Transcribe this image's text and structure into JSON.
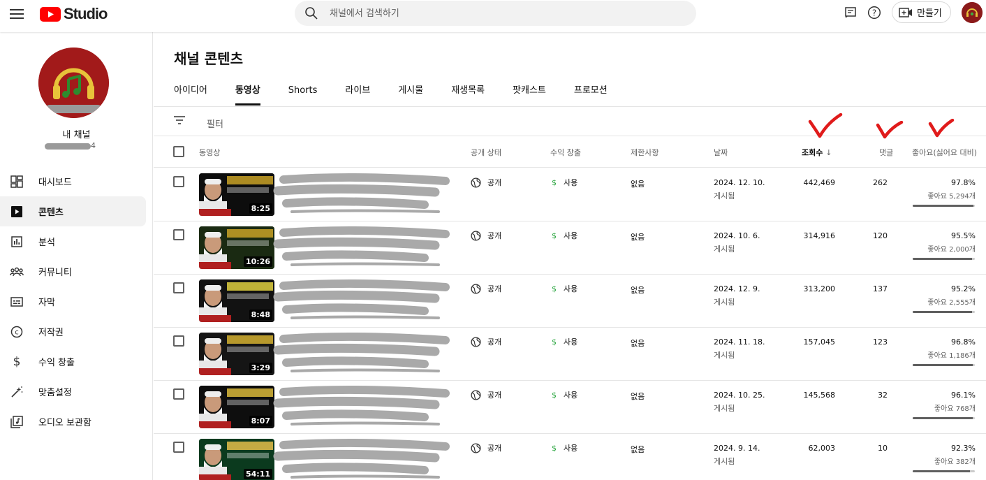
{
  "header": {
    "logo_text": "Studio",
    "search_placeholder": "채널에서 검색하기",
    "create_label": "만들기"
  },
  "sidebar": {
    "channel_label": "내 채널",
    "channel_sub_suffix": "4",
    "items": [
      {
        "label": "대시보드",
        "icon": "dashboard-icon",
        "active": false
      },
      {
        "label": "콘텐츠",
        "icon": "content-icon",
        "active": true
      },
      {
        "label": "분석",
        "icon": "analytics-icon",
        "active": false
      },
      {
        "label": "커뮤니티",
        "icon": "community-icon",
        "active": false
      },
      {
        "label": "자막",
        "icon": "subtitles-icon",
        "active": false
      },
      {
        "label": "저작권",
        "icon": "copyright-icon",
        "active": false
      },
      {
        "label": "수익 창출",
        "icon": "monetization-icon",
        "active": false
      },
      {
        "label": "맞춤설정",
        "icon": "customization-icon",
        "active": false
      },
      {
        "label": "오디오 보관함",
        "icon": "audio-library-icon",
        "active": false
      }
    ]
  },
  "main": {
    "title": "채널 콘텐츠",
    "tabs": [
      "아이디어",
      "동영상",
      "Shorts",
      "라이브",
      "게시물",
      "재생목록",
      "팟캐스트",
      "프로모션"
    ],
    "active_tab": 1,
    "filter_label": "필터",
    "columns": {
      "video": "동영상",
      "visibility": "공개 상태",
      "monetization": "수익 창출",
      "restrictions": "제한사항",
      "date": "날짜",
      "views": "조회수",
      "comments": "댓글",
      "likes": "좋아요(싫어요 대비)"
    },
    "rows": [
      {
        "duration": "8:25",
        "visibility": "공개",
        "monetization": "사용",
        "restrictions": "없음",
        "date": "2024. 12. 10.",
        "date_sub": "게시됨",
        "views": "442,469",
        "comments": "262",
        "like_pct": "97.8%",
        "like_count": "좋아요 5,294개",
        "like_fraction": 0.978
      },
      {
        "duration": "10:26",
        "visibility": "공개",
        "monetization": "사용",
        "restrictions": "없음",
        "date": "2024. 10. 6.",
        "date_sub": "게시됨",
        "views": "314,916",
        "comments": "120",
        "like_pct": "95.5%",
        "like_count": "좋아요 2,000개",
        "like_fraction": 0.955
      },
      {
        "duration": "8:48",
        "visibility": "공개",
        "monetization": "사용",
        "restrictions": "없음",
        "date": "2024. 12. 9.",
        "date_sub": "게시됨",
        "views": "313,200",
        "comments": "137",
        "like_pct": "95.2%",
        "like_count": "좋아요 2,555개",
        "like_fraction": 0.952
      },
      {
        "duration": "3:29",
        "visibility": "공개",
        "monetization": "사용",
        "restrictions": "없음",
        "date": "2024. 11. 18.",
        "date_sub": "게시됨",
        "views": "157,045",
        "comments": "123",
        "like_pct": "96.8%",
        "like_count": "좋아요 1,186개",
        "like_fraction": 0.968
      },
      {
        "duration": "8:07",
        "visibility": "공개",
        "monetization": "사용",
        "restrictions": "없음",
        "date": "2024. 10. 25.",
        "date_sub": "게시됨",
        "views": "145,568",
        "comments": "32",
        "like_pct": "96.1%",
        "like_count": "좋아요 768개",
        "like_fraction": 0.961
      },
      {
        "duration": "54:11",
        "visibility": "공개",
        "monetization": "사용",
        "restrictions": "없음",
        "date": "2024. 9. 14.",
        "date_sub": "게시됨",
        "views": "62,003",
        "comments": "10",
        "like_pct": "92.3%",
        "like_count": "좋아요 382개",
        "like_fraction": 0.923
      }
    ]
  },
  "colors": {
    "brand_red": "#ff0000",
    "money_green": "#2ba640",
    "annotation_red": "#e01b1b"
  }
}
